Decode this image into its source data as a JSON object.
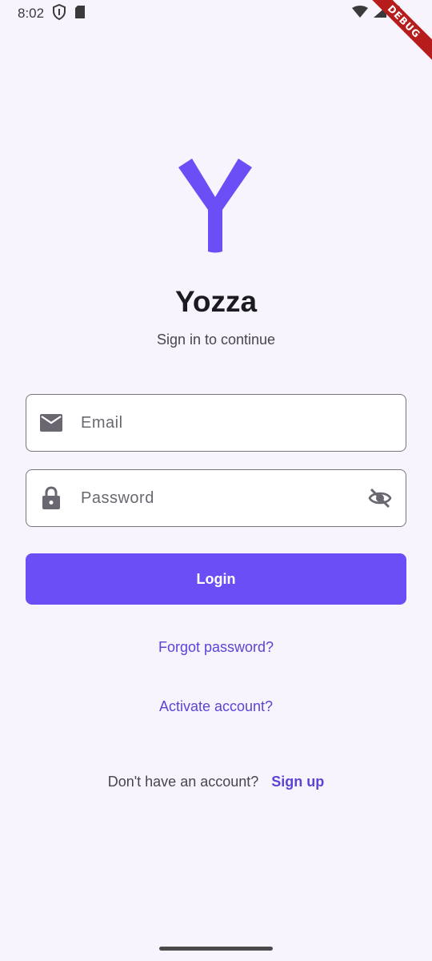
{
  "status_bar": {
    "time": "8:02",
    "icons": [
      "shield-icon",
      "sd-card-icon",
      "wifi-icon",
      "signal-icon",
      "battery-icon"
    ]
  },
  "debug_banner": "DEBUG",
  "logo": {
    "icon": "y-logo-icon",
    "color": "#6c4ef6"
  },
  "app": {
    "title": "Yozza",
    "subtitle": "Sign in to continue"
  },
  "form": {
    "email": {
      "placeholder": "Email",
      "value": "",
      "icon": "email-icon"
    },
    "password": {
      "placeholder": "Password",
      "value": "",
      "icon": "lock-icon",
      "toggle_icon": "visibility-off-icon"
    },
    "login_label": "Login"
  },
  "links": {
    "forgot_password": "Forgot password?",
    "activate_account": "Activate account?"
  },
  "signup": {
    "prompt": "Don't have an account?",
    "link": "Sign up"
  },
  "colors": {
    "accent": "#6c4ef6",
    "link": "#5b44d6",
    "background": "#f8f4fd"
  }
}
